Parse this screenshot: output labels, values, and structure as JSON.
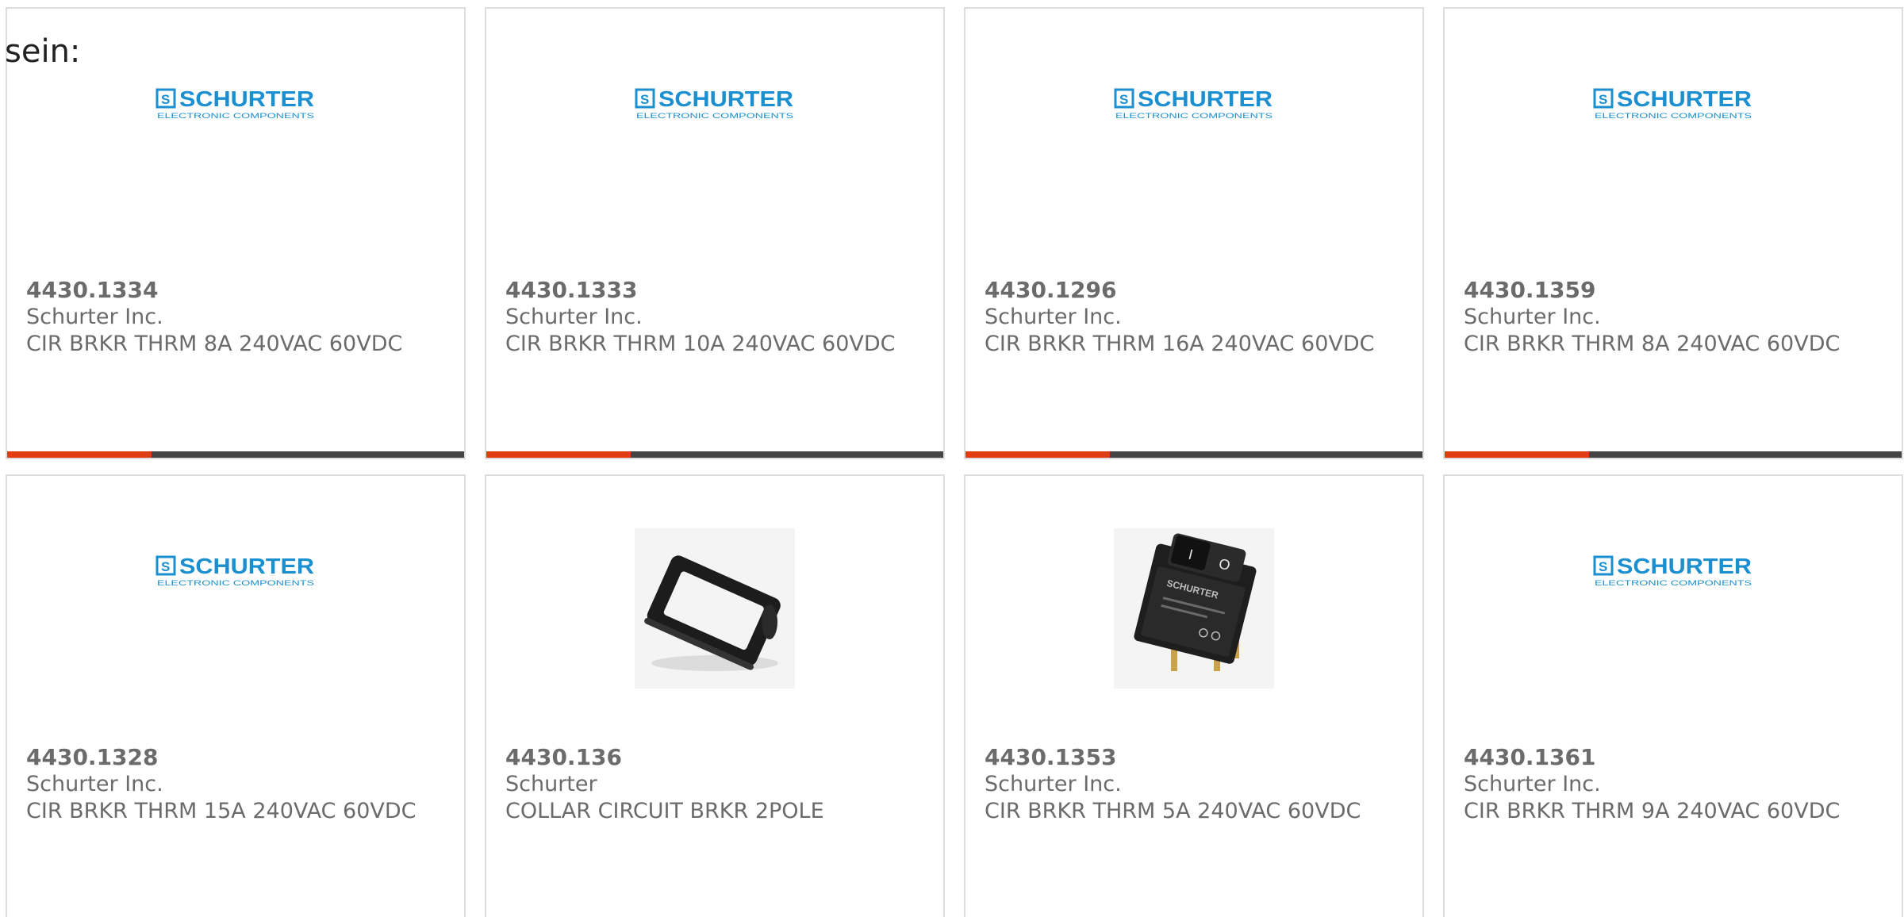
{
  "intro_text": "sein:",
  "colors": {
    "brand_blue": "#1b8fd0",
    "accent": "#e23c12",
    "bar": "#444444",
    "text": "#6b6b6b",
    "border": "#dddddd"
  },
  "products": [
    {
      "part": "4430.1334",
      "manufacturer": "Schurter Inc.",
      "description": "CIR BRKR THRM 8A 240VAC 60VDC",
      "image": "schurter-logo"
    },
    {
      "part": "4430.1333",
      "manufacturer": "Schurter Inc.",
      "description": "CIR BRKR THRM 10A 240VAC 60VDC",
      "image": "schurter-logo"
    },
    {
      "part": "4430.1296",
      "manufacturer": "Schurter Inc.",
      "description": "CIR BRKR THRM 16A 240VAC 60VDC",
      "image": "schurter-logo"
    },
    {
      "part": "4430.1359",
      "manufacturer": "Schurter Inc.",
      "description": "CIR BRKR THRM 8A 240VAC 60VDC",
      "image": "schurter-logo"
    },
    {
      "part": "4430.1328",
      "manufacturer": "Schurter Inc.",
      "description": "CIR BRKR THRM 15A 240VAC 60VDC",
      "image": "schurter-logo"
    },
    {
      "part": "4430.136",
      "manufacturer": "Schurter",
      "description": "COLLAR CIRCUIT BRKR 2POLE",
      "image": "collar-photo"
    },
    {
      "part": "4430.1353",
      "manufacturer": "Schurter Inc.",
      "description": "CIR BRKR THRM 5A 240VAC 60VDC",
      "image": "breaker-photo"
    },
    {
      "part": "4430.1361",
      "manufacturer": "Schurter Inc.",
      "description": "CIR BRKR THRM 9A 240VAC 60VDC",
      "image": "schurter-logo"
    }
  ],
  "logo": {
    "wordmark": "SCHURTER",
    "tagline": "ELECTRONIC COMPONENTS",
    "mark": "S"
  },
  "breaker_label": {
    "brand": "SCHURTER",
    "switch_on": "I",
    "switch_off": "O"
  }
}
